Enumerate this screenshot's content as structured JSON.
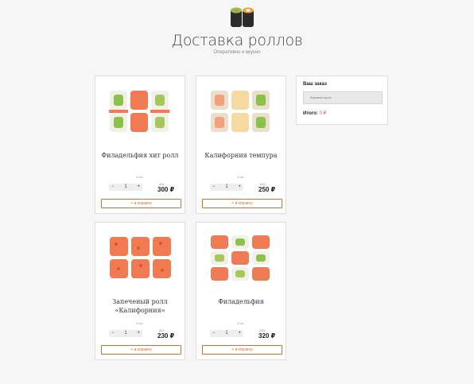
{
  "header": {
    "title": "Доставка роллов",
    "subtitle": "Оперативно и вкусно"
  },
  "products": [
    {
      "name": "Филадельфия хит ролл",
      "qty_label": "8 шт.",
      "qty": "1",
      "weight": "180г",
      "price": "300 ₽",
      "button": "+ в корзину",
      "image": "philadelphia-hit-roll"
    },
    {
      "name": "Калифорния темпура",
      "qty_label": "8 шт.",
      "qty": "1",
      "weight": "180г",
      "price": "250 ₽",
      "button": "+ в корзину",
      "image": "california-tempura"
    },
    {
      "name": "Запеченый ролл «Калифорния»",
      "qty_label": "8 шт.",
      "qty": "1",
      "weight": "180г",
      "price": "230 ₽",
      "button": "+ в корзину",
      "image": "baked-california"
    },
    {
      "name": "Филадельфия",
      "qty_label": "8 шт.",
      "qty": "1",
      "weight": "290г",
      "price": "320 ₽",
      "button": "+ в корзину",
      "image": "philadelphia"
    }
  ],
  "stepper": {
    "minus": "−",
    "plus": "+"
  },
  "order": {
    "title": "Ваш заказ",
    "empty": "Корзина пуста",
    "total_label": "Итого:",
    "total_value": "0 ₽"
  },
  "colors": {
    "accent": "#c8733c",
    "salmon": "#f07a52",
    "total": "#d9534f"
  }
}
